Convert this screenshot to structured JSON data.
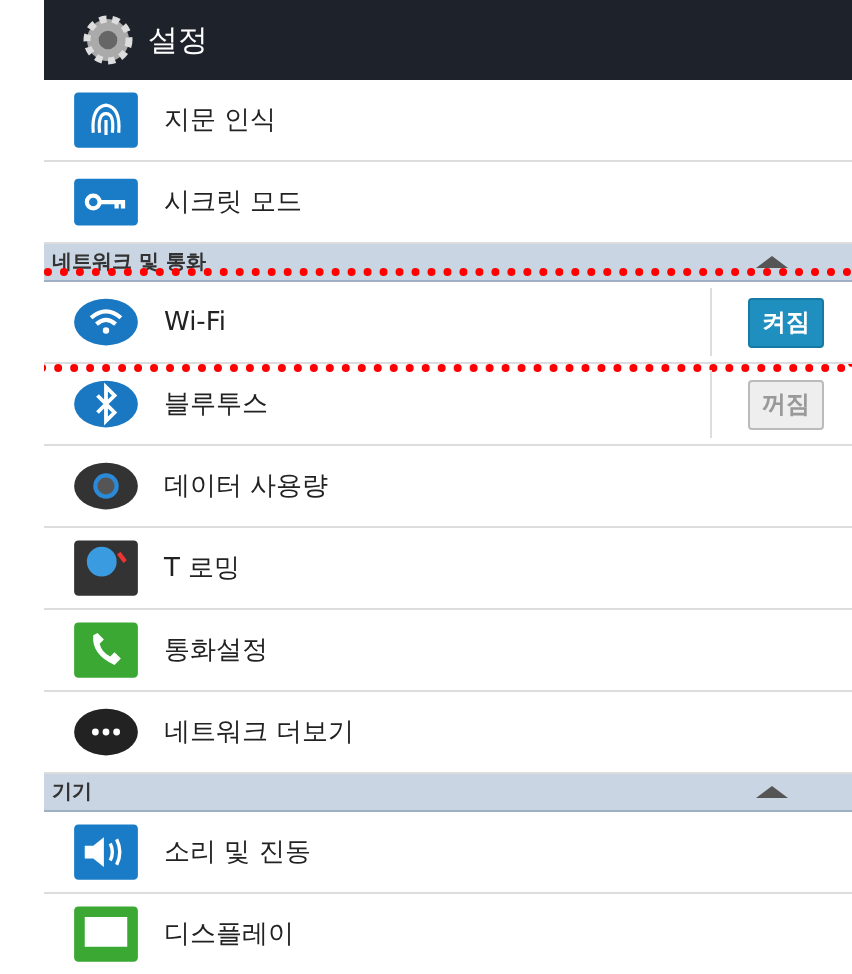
{
  "header": {
    "title": "설정"
  },
  "groups": [
    {
      "items": [
        {
          "label": "지문 인식"
        },
        {
          "label": "시크릿 모드"
        }
      ]
    },
    {
      "title": "네트워크 및 통화",
      "expanded": true,
      "items": [
        {
          "label": "Wi-Fi",
          "toggle": {
            "label": "켜짐",
            "on": true
          },
          "highlighted": true
        },
        {
          "label": "블루투스",
          "toggle": {
            "label": "꺼짐",
            "on": false
          }
        },
        {
          "label": "데이터 사용량"
        },
        {
          "label": "T 로밍"
        },
        {
          "label": "통화설정"
        },
        {
          "label": "네트워크 더보기"
        }
      ]
    },
    {
      "title": "기기",
      "expanded": true,
      "items": [
        {
          "label": "소리 및 진동"
        },
        {
          "label": "디스플레이"
        }
      ]
    }
  ]
}
